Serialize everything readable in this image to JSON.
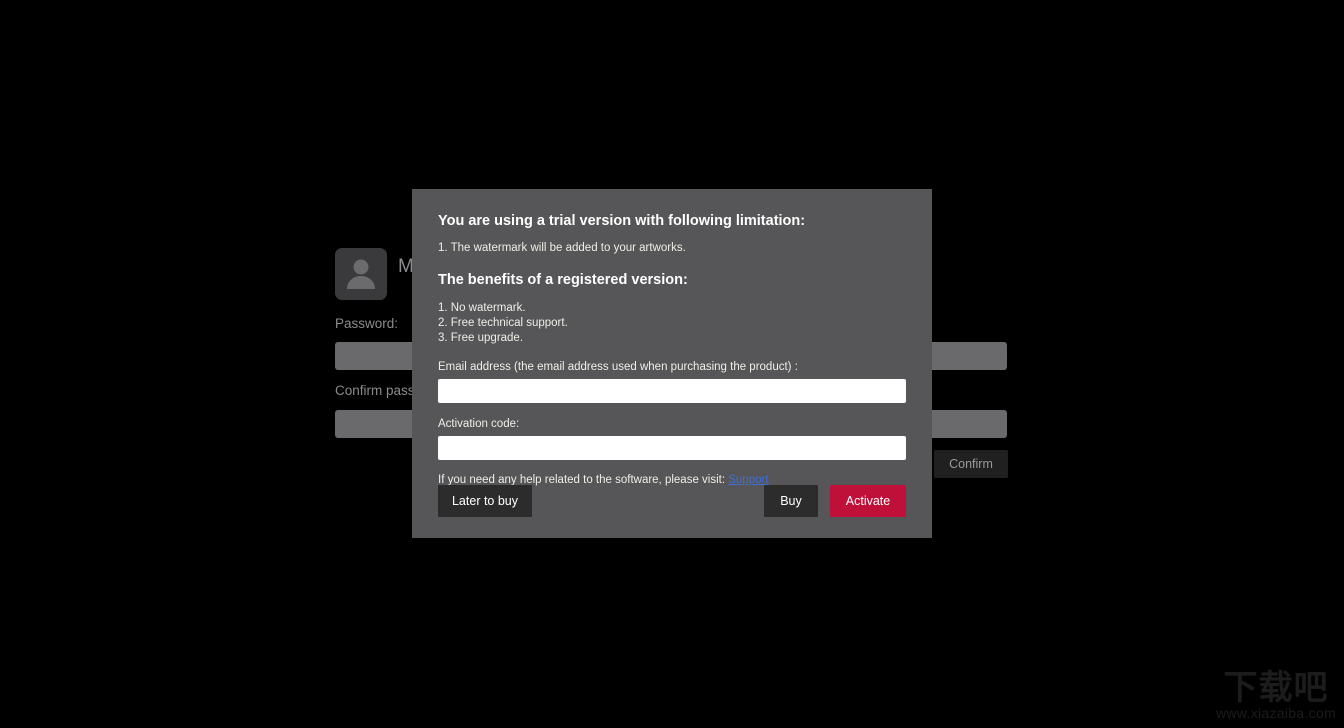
{
  "background_app": {
    "avatar_icon": "user-avatar-icon",
    "username": "M",
    "password_label": "Password:",
    "password_value": "",
    "confirm_label": "Confirm password:",
    "confirm_value": "",
    "confirm_button_label": "Confirm"
  },
  "watermark": {
    "logo_text": "下载吧",
    "url_text": "www.xiazaiba.com",
    "color": "#1c1c1c"
  },
  "dialog": {
    "trial_heading": "You are using a trial version with following limitation:",
    "limitation": "1. The watermark will be added to your artworks.",
    "benefits_heading": "The benefits of a registered version:",
    "benefits": [
      "1. No watermark.",
      "2. Free technical support.",
      "3. Free upgrade."
    ],
    "email_label": "Email address (the email address used when purchasing the product) :",
    "email_value": "",
    "email_placeholder": "",
    "activation_label": "Activation code:",
    "activation_value": "",
    "activation_placeholder": "",
    "help_prefix": "If you need any help related to the software, please visit: ",
    "help_link_label": "Support",
    "buttons": {
      "later": "Later to buy",
      "buy": "Buy",
      "activate": "Activate"
    },
    "colors": {
      "dialog_bg": "#565557",
      "activate_bg": "#bf1039",
      "neutral_button_bg": "#2c2c2c",
      "link": "#3f6fd4"
    }
  }
}
